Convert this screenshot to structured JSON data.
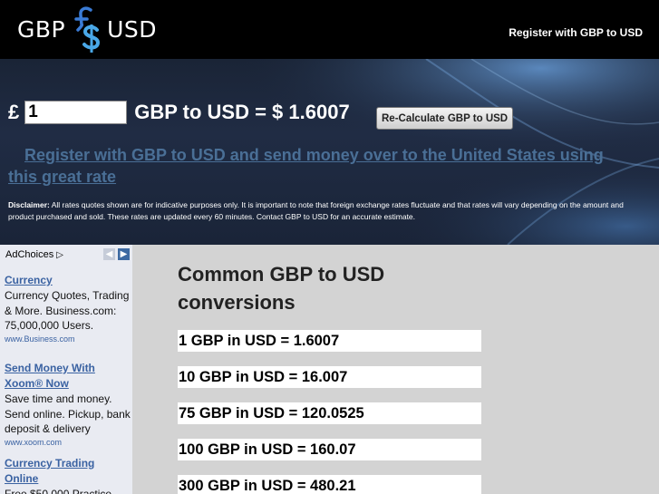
{
  "header": {
    "logo_left": "GBP",
    "logo_right": "USD",
    "register_link": "Register with GBP to USD"
  },
  "calculator": {
    "currency_symbol": "£",
    "amount_value": "1",
    "result_text": "GBP to USD = $ 1.6007",
    "recalc_button": "Re-Calculate GBP to USD"
  },
  "promo": {
    "register_link": "Register with GBP to USD and send money over to the United States using this great rate"
  },
  "disclaimer": {
    "label": "Disclaimer:",
    "text": " All rates quotes shown are for indicative purposes only. It is important to note that foreign exchange rates fluctuate and that rates will vary depending on the amount and product purchased and sold. These rates are updated every 60 minutes. Contact GBP to USD for an accurate estimate."
  },
  "sidebar": {
    "adchoices_label": "AdChoices",
    "ads": [
      {
        "title": "Currency",
        "body": "Currency Quotes, Trading & More. Business.com: 75,000,000 Users.",
        "url": "www.Business.com"
      },
      {
        "title": "Send Money With Xoom® Now",
        "body": "Save time and money. Send online. Pickup, bank deposit & delivery",
        "url": "www.xoom.com"
      },
      {
        "title": "Currency Trading Online",
        "body": "Free $50,000 Practice",
        "url": ""
      }
    ]
  },
  "main": {
    "title": "Common GBP to USD conversions",
    "conversions": [
      "1 GBP in USD = 1.6007",
      "10 GBP in USD = 16.007",
      "75 GBP in USD = 120.0525",
      "100 GBP in USD = 160.07",
      "300 GBP in USD = 480.21"
    ]
  },
  "colors": {
    "header_bg": "#000000",
    "link_blue": "#4a6f96",
    "ad_link": "#3a62a2",
    "main_bg": "#d3d3d3",
    "sidebar_bg": "#e9ebf2"
  },
  "icons": {
    "logo_mark": "pound-dollar-logo-icon",
    "adchoices": "adchoices-triangle-icon",
    "prev": "chevron-left-icon",
    "next": "chevron-right-icon"
  }
}
